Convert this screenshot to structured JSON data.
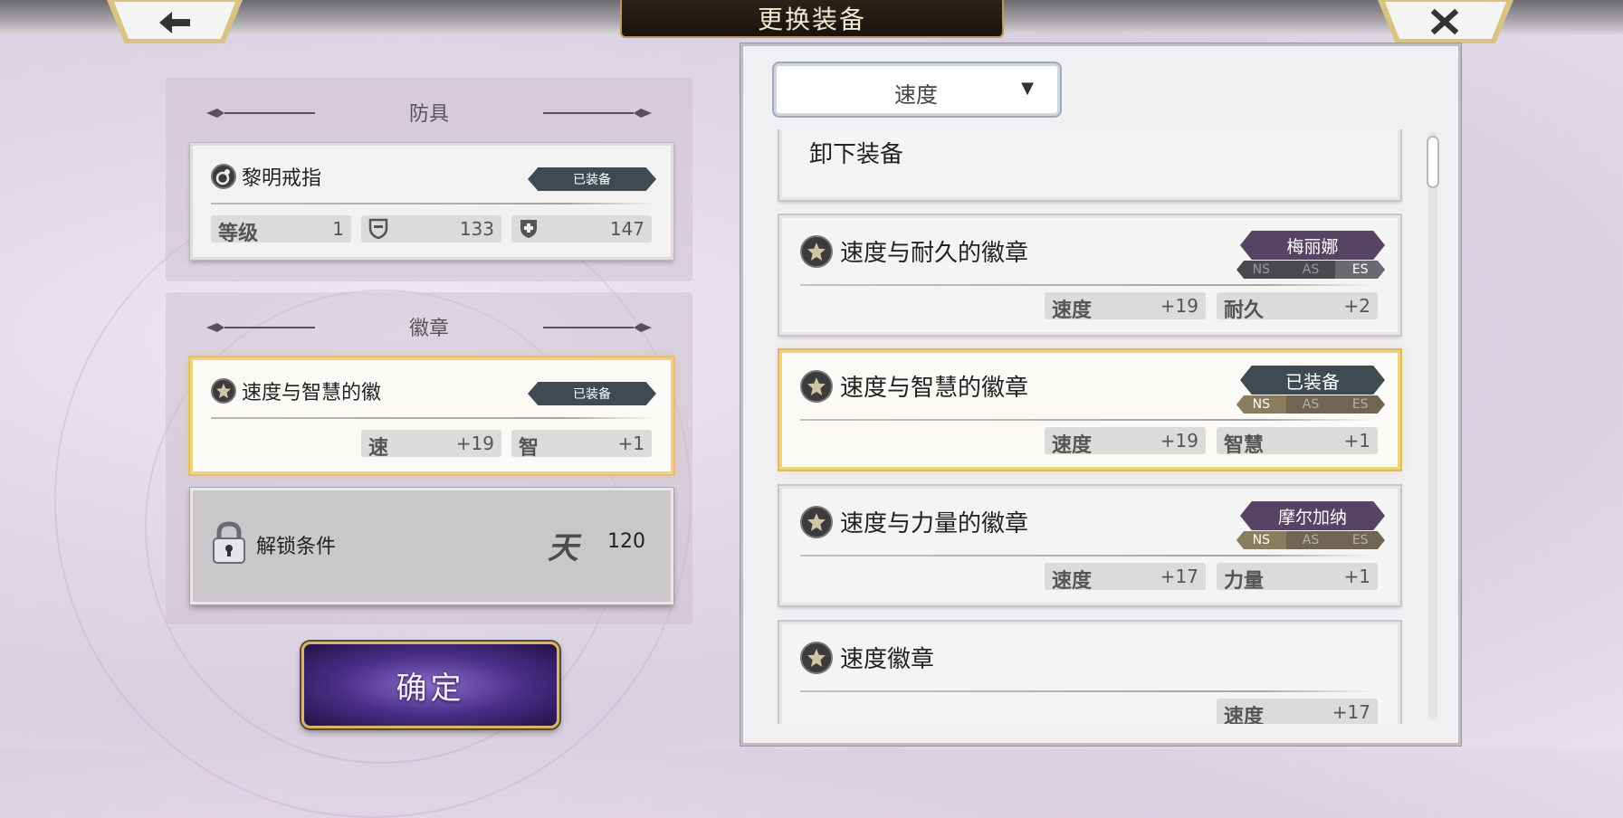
{
  "header": {
    "title": "更换装备",
    "back_icon": "arrow-left-icon",
    "close_icon": "close-icon"
  },
  "armor_section": {
    "heading": "防具",
    "item": {
      "name": "黎明戒指",
      "equipped_label": "已装备",
      "stats": [
        {
          "label": "等级",
          "value": "1"
        },
        {
          "icon": "shield-icon",
          "value": "133"
        },
        {
          "icon": "shield-plus-icon",
          "value": "147"
        }
      ]
    }
  },
  "badge_section": {
    "heading": "徽章",
    "item": {
      "name": "速度与智慧的徽",
      "equipped_label": "已装备",
      "stats": [
        {
          "label": "速",
          "value": "+19"
        },
        {
          "label": "智",
          "value": "+1"
        }
      ]
    },
    "lock": {
      "label": "解锁条件",
      "glyph": "天",
      "value": "120"
    }
  },
  "confirm_label": "确定",
  "filter": {
    "selected": "速度",
    "caret": "▼"
  },
  "badge_list": [
    {
      "type": "unequip",
      "label": "卸下装备"
    },
    {
      "name": "速度与耐久的徽章",
      "tag": "梅丽娜",
      "versions": [
        "NS",
        "AS",
        "ES"
      ],
      "active_versions": [
        "ES"
      ],
      "stats": [
        {
          "label": "速度",
          "value": "+19"
        },
        {
          "label": "耐久",
          "value": "+2"
        }
      ]
    },
    {
      "name": "速度与智慧的徽章",
      "tag": "已装备",
      "versions": [
        "NS",
        "AS",
        "ES"
      ],
      "active_versions": [
        "NS"
      ],
      "stats": [
        {
          "label": "速度",
          "value": "+19"
        },
        {
          "label": "智慧",
          "value": "+1"
        }
      ]
    },
    {
      "name": "速度与力量的徽章",
      "tag": "摩尔加纳",
      "versions": [
        "NS",
        "AS",
        "ES"
      ],
      "active_versions": [
        "NS"
      ],
      "stats": [
        {
          "label": "速度",
          "value": "+17"
        },
        {
          "label": "力量",
          "value": "+1"
        }
      ]
    },
    {
      "name": "速度徽章",
      "stats": [
        {
          "label": "速度",
          "value": "+17"
        }
      ]
    }
  ],
  "colors": {
    "gold": "#e5c06a",
    "tag_purple": "#574465",
    "tag_dark": "#3f4a52"
  }
}
